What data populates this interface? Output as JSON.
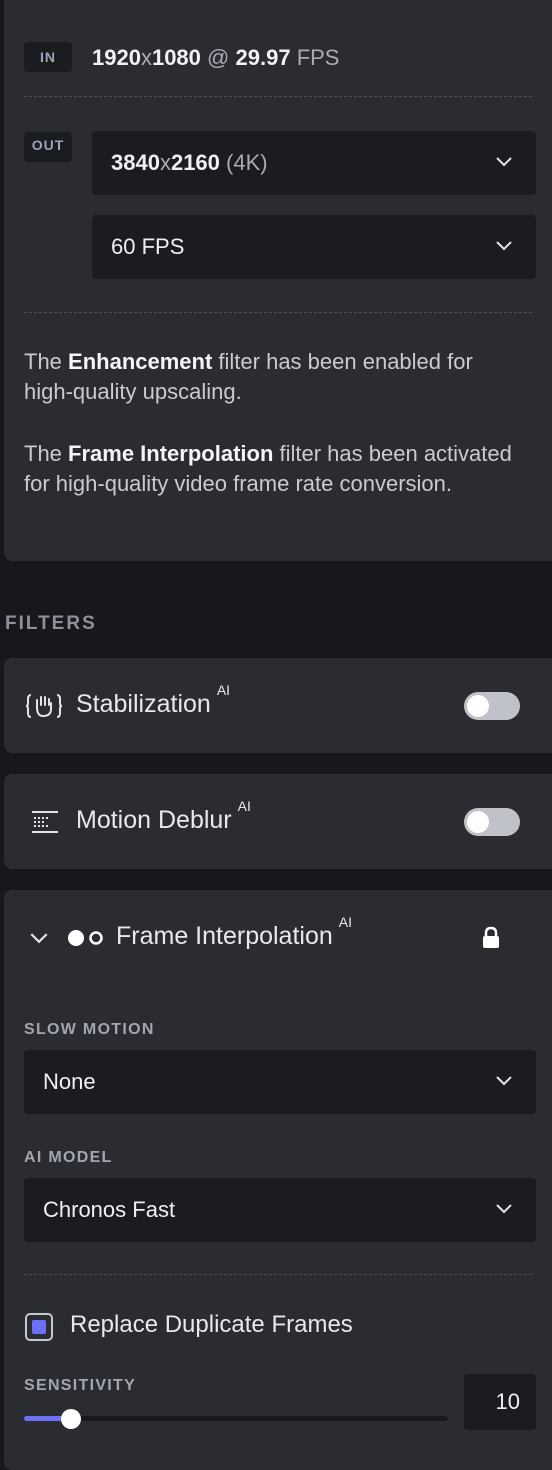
{
  "input": {
    "tag": "IN",
    "width": "1920",
    "x": "x",
    "height": "1080",
    "at": "@",
    "fps_value": "29.97",
    "fps_unit": "FPS"
  },
  "output": {
    "tag": "OUT",
    "resolution": {
      "width": "3840",
      "x": "x",
      "height": "2160",
      "suffix": "(4K)"
    },
    "frame_rate": "60 FPS"
  },
  "info": {
    "enhancement": {
      "pre": "The ",
      "bold": "Enhancement",
      "post": " filter has been enabled for high-quality upscaling."
    },
    "interpolation": {
      "pre": "The ",
      "bold": "Frame Interpolation",
      "post": " filter has been activated for high-quality video frame rate conversion."
    }
  },
  "filters": {
    "heading": "FILTERS",
    "items": [
      {
        "label": "Stabilization",
        "badge": "AI",
        "enabled": false,
        "icon": "stabilization-icon"
      },
      {
        "label": "Motion Deblur",
        "badge": "AI",
        "enabled": false,
        "icon": "motion-deblur-icon"
      }
    ],
    "frame_interpolation": {
      "label": "Frame Interpolation",
      "badge": "AI",
      "icon": "frame-interpolation-icon",
      "locked": true,
      "slow_motion": {
        "label": "SLOW MOTION",
        "value": "None"
      },
      "ai_model": {
        "label": "AI MODEL",
        "value": "Chronos Fast"
      },
      "replace_duplicates": {
        "label": "Replace Duplicate Frames",
        "checked": true
      },
      "sensitivity": {
        "label": "SENSITIVITY",
        "value": "10",
        "level": 0.11
      }
    }
  },
  "colors": {
    "accent": "#6d6ff7",
    "panel": "#2b2c31",
    "background": "#17181c"
  }
}
